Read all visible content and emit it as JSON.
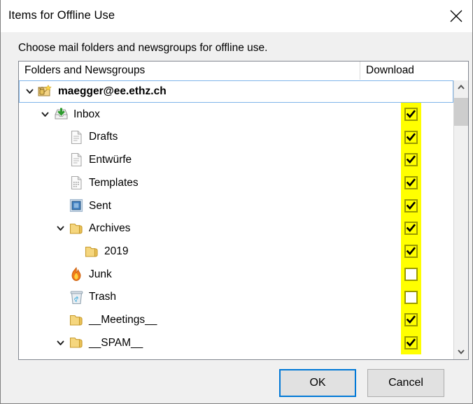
{
  "window": {
    "title": "Items for Offline Use",
    "close_icon": "close-icon"
  },
  "instruction": "Choose mail folders and newsgroups for offline use.",
  "columns": {
    "folders": "Folders and Newsgroups",
    "download": "Download"
  },
  "tree": {
    "rows": [
      {
        "label": "maegger@ee.ethz.ch",
        "icon": "account-mail-lock-icon",
        "depth": 0,
        "expander": "expanded",
        "selected": true,
        "checkbox": "none",
        "bold": true
      },
      {
        "label": "Inbox",
        "icon": "inbox-tray-icon",
        "depth": 1,
        "expander": "expanded",
        "selected": false,
        "checkbox": "checked",
        "bold": false
      },
      {
        "label": "Drafts",
        "icon": "document-icon",
        "depth": 2,
        "expander": "none",
        "selected": false,
        "checkbox": "checked",
        "bold": false
      },
      {
        "label": "Entwürfe",
        "icon": "document-icon",
        "depth": 2,
        "expander": "none",
        "selected": false,
        "checkbox": "checked",
        "bold": false
      },
      {
        "label": "Templates",
        "icon": "template-document-icon",
        "depth": 2,
        "expander": "none",
        "selected": false,
        "checkbox": "checked",
        "bold": false
      },
      {
        "label": "Sent",
        "icon": "sent-stamp-icon",
        "depth": 2,
        "expander": "none",
        "selected": false,
        "checkbox": "checked",
        "bold": false
      },
      {
        "label": "Archives",
        "icon": "folder-icon",
        "depth": 2,
        "expander": "expanded",
        "selected": false,
        "checkbox": "checked",
        "bold": false
      },
      {
        "label": "2019",
        "icon": "folder-icon",
        "depth": 3,
        "expander": "none",
        "selected": false,
        "checkbox": "checked",
        "bold": false
      },
      {
        "label": "Junk",
        "icon": "junk-flame-icon",
        "depth": 2,
        "expander": "none",
        "selected": false,
        "checkbox": "unchecked",
        "bold": false
      },
      {
        "label": "Trash",
        "icon": "trash-bin-icon",
        "depth": 2,
        "expander": "none",
        "selected": false,
        "checkbox": "unchecked",
        "bold": false
      },
      {
        "label": "__Meetings__",
        "icon": "folder-icon",
        "depth": 2,
        "expander": "none",
        "selected": false,
        "checkbox": "checked",
        "bold": false
      },
      {
        "label": "__SPAM__",
        "icon": "folder-icon",
        "depth": 2,
        "expander": "expanded",
        "selected": false,
        "checkbox": "checked",
        "bold": false
      }
    ]
  },
  "scrollbar": {
    "up_icon": "chevron-up-icon",
    "down_icon": "chevron-down-icon"
  },
  "buttons": {
    "ok": "OK",
    "cancel": "Cancel"
  },
  "colors": {
    "highlight": "#ffff00",
    "checkbox_border": "#9a9a00",
    "default_button_border": "#0078d7",
    "selection_border": "#7eb4ea",
    "dialog_background": "#f0f0f0"
  }
}
